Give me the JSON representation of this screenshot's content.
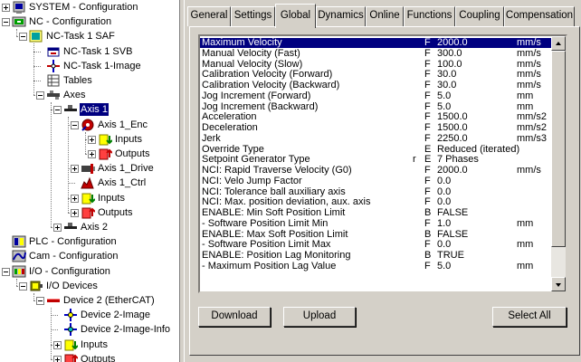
{
  "tree": {
    "items": [
      {
        "label": "SYSTEM - Configuration",
        "icon": "system-config-icon"
      },
      {
        "label": "NC - Configuration",
        "icon": "nc-config-icon"
      },
      {
        "label": "NC-Task 1 SAF",
        "icon": "nc-task-icon"
      },
      {
        "label": "NC-Task 1 SVB",
        "icon": "nc-task-svb-icon"
      },
      {
        "label": "NC-Task 1-Image",
        "icon": "nc-task-image-icon"
      },
      {
        "label": "Tables",
        "icon": "tables-icon"
      },
      {
        "label": "Axes",
        "icon": "axes-icon"
      },
      {
        "label": "Axis 1",
        "icon": "axis-icon"
      },
      {
        "label": "Axis 1_Enc",
        "icon": "encoder-icon"
      },
      {
        "label": "Inputs",
        "icon": "inputs-icon"
      },
      {
        "label": "Outputs",
        "icon": "outputs-icon"
      },
      {
        "label": "Axis 1_Drive",
        "icon": "drive-icon"
      },
      {
        "label": "Axis 1_Ctrl",
        "icon": "controller-icon"
      },
      {
        "label": "Inputs",
        "icon": "inputs-icon"
      },
      {
        "label": "Outputs",
        "icon": "outputs-icon"
      },
      {
        "label": "Axis 2",
        "icon": "axis-icon"
      },
      {
        "label": "PLC - Configuration",
        "icon": "plc-config-icon"
      },
      {
        "label": "Cam - Configuration",
        "icon": "cam-config-icon"
      },
      {
        "label": "I/O - Configuration",
        "icon": "io-config-icon"
      },
      {
        "label": "I/O Devices",
        "icon": "io-devices-icon"
      },
      {
        "label": "Device 2 (EtherCAT)",
        "icon": "ethercat-device-icon"
      },
      {
        "label": "Device 2-Image",
        "icon": "device-image-icon"
      },
      {
        "label": "Device 2-Image-Info",
        "icon": "device-image-info-icon"
      },
      {
        "label": "Inputs",
        "icon": "inputs-icon"
      },
      {
        "label": "Outputs",
        "icon": "outputs-icon"
      }
    ],
    "selected": "Axis 1"
  },
  "tabs": [
    "General",
    "Settings",
    "Global",
    "Dynamics",
    "Online",
    "Functions",
    "Coupling",
    "Compensation"
  ],
  "active_tab": "Global",
  "parameters": [
    {
      "name": "Maximum Velocity",
      "flag": "",
      "type": "F",
      "value": "2000.0",
      "unit": "mm/s"
    },
    {
      "name": "Manual Velocity (Fast)",
      "flag": "",
      "type": "F",
      "value": "300.0",
      "unit": "mm/s"
    },
    {
      "name": "Manual Velocity (Slow)",
      "flag": "",
      "type": "F",
      "value": "100.0",
      "unit": "mm/s"
    },
    {
      "name": "Calibration Velocity (Forward)",
      "flag": "",
      "type": "F",
      "value": "30.0",
      "unit": "mm/s"
    },
    {
      "name": "Calibration Velocity (Backward)",
      "flag": "",
      "type": "F",
      "value": "30.0",
      "unit": "mm/s"
    },
    {
      "name": "Jog Increment (Forward)",
      "flag": "",
      "type": "F",
      "value": "5.0",
      "unit": "mm"
    },
    {
      "name": "Jog Increment (Backward)",
      "flag": "",
      "type": "F",
      "value": "5.0",
      "unit": "mm"
    },
    {
      "name": "Acceleration",
      "flag": "",
      "type": "F",
      "value": "1500.0",
      "unit": "mm/s2"
    },
    {
      "name": "Deceleration",
      "flag": "",
      "type": "F",
      "value": "1500.0",
      "unit": "mm/s2"
    },
    {
      "name": "Jerk",
      "flag": "",
      "type": "F",
      "value": "2250.0",
      "unit": "mm/s3"
    },
    {
      "name": "Override Type",
      "flag": "",
      "type": "E",
      "value": "Reduced (iterated)",
      "unit": ""
    },
    {
      "name": "Setpoint Generator Type",
      "flag": "r",
      "type": "E",
      "value": "7 Phases",
      "unit": ""
    },
    {
      "name": "NCI: Rapid Traverse Velocity (G0)",
      "flag": "",
      "type": "F",
      "value": "2000.0",
      "unit": "mm/s"
    },
    {
      "name": "NCI: Velo Jump Factor",
      "flag": "",
      "type": "F",
      "value": "0.0",
      "unit": ""
    },
    {
      "name": "NCI: Tolerance ball auxiliary axis",
      "flag": "",
      "type": "F",
      "value": "0.0",
      "unit": ""
    },
    {
      "name": "NCI: Max. position deviation, aux. axis",
      "flag": "",
      "type": "F",
      "value": "0.0",
      "unit": ""
    },
    {
      "name": "ENABLE: Min Soft Position Limit",
      "flag": "",
      "type": "B",
      "value": "FALSE",
      "unit": ""
    },
    {
      "name": " - Software Position Limit Min",
      "flag": "",
      "type": "F",
      "value": "1.0",
      "unit": "mm"
    },
    {
      "name": "ENABLE: Max Soft Position Limit",
      "flag": "",
      "type": "B",
      "value": "FALSE",
      "unit": ""
    },
    {
      "name": " - Software Position Limit Max",
      "flag": "",
      "type": "F",
      "value": "0.0",
      "unit": "mm"
    },
    {
      "name": "ENABLE: Position Lag Monitoring",
      "flag": "",
      "type": "B",
      "value": "TRUE",
      "unit": ""
    },
    {
      "name": " - Maximum Position Lag Value",
      "flag": "",
      "type": "F",
      "value": "5.0",
      "unit": "mm"
    }
  ],
  "selected_parameter": "Maximum Velocity",
  "buttons": {
    "download": "Download",
    "upload": "Upload",
    "select_all": "Select All"
  },
  "colors": {
    "selection": "#000080",
    "face": "#d4d0c8"
  }
}
